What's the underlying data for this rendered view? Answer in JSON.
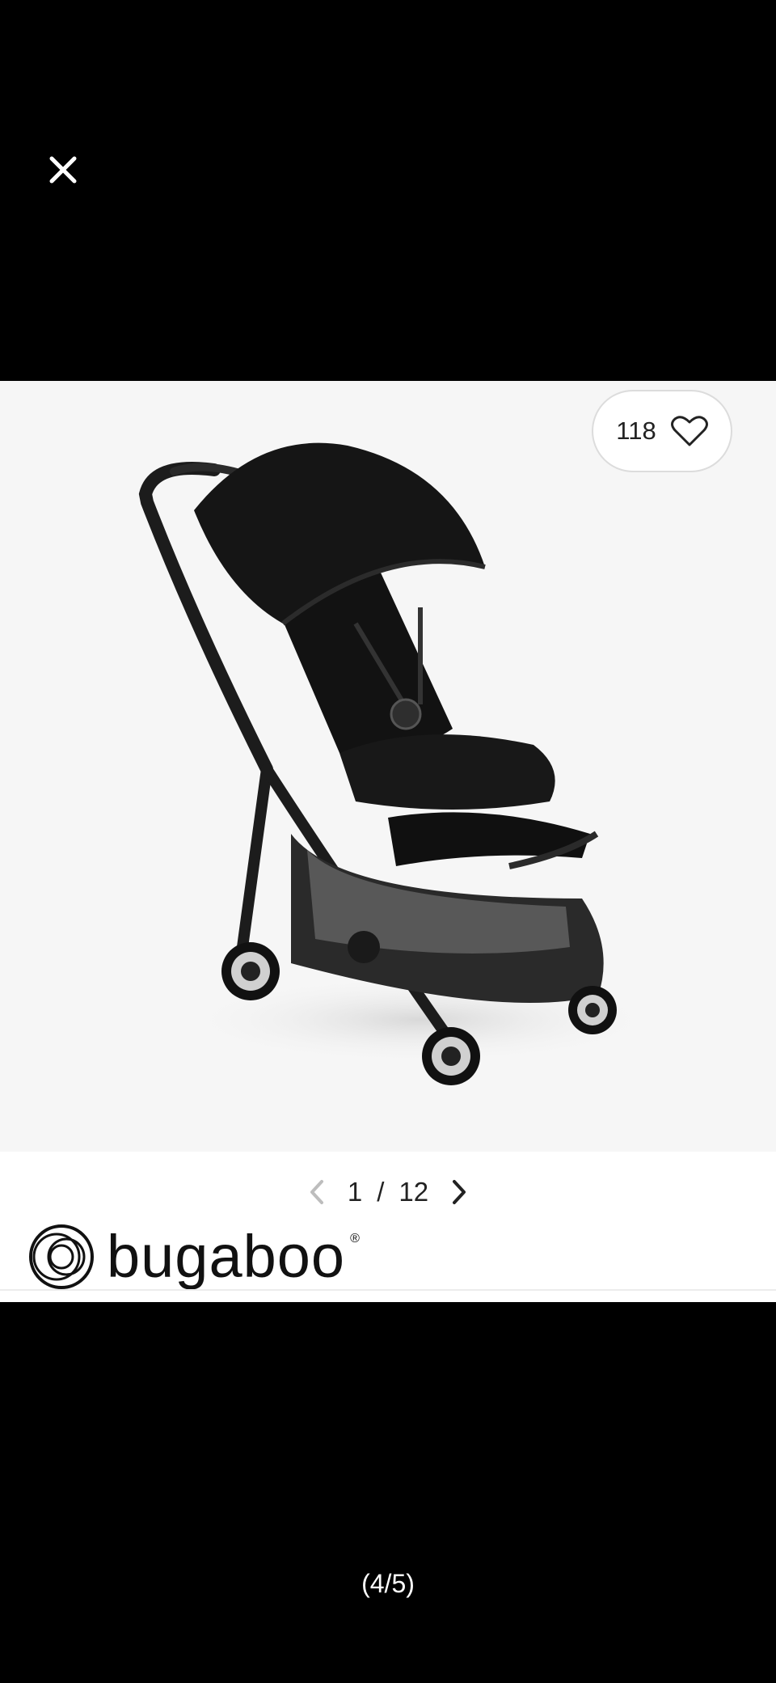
{
  "viewer": {
    "page_indicator": "(4/5)"
  },
  "product": {
    "likes": "118",
    "image_subject": "black stroller"
  },
  "pager": {
    "current": "1",
    "separator": "/",
    "total": "12"
  },
  "brand": {
    "name": "bugaboo",
    "registered_mark": "®"
  },
  "colors": {
    "background": "#000000",
    "card": "#ffffff",
    "image_bg": "#f6f6f6"
  }
}
